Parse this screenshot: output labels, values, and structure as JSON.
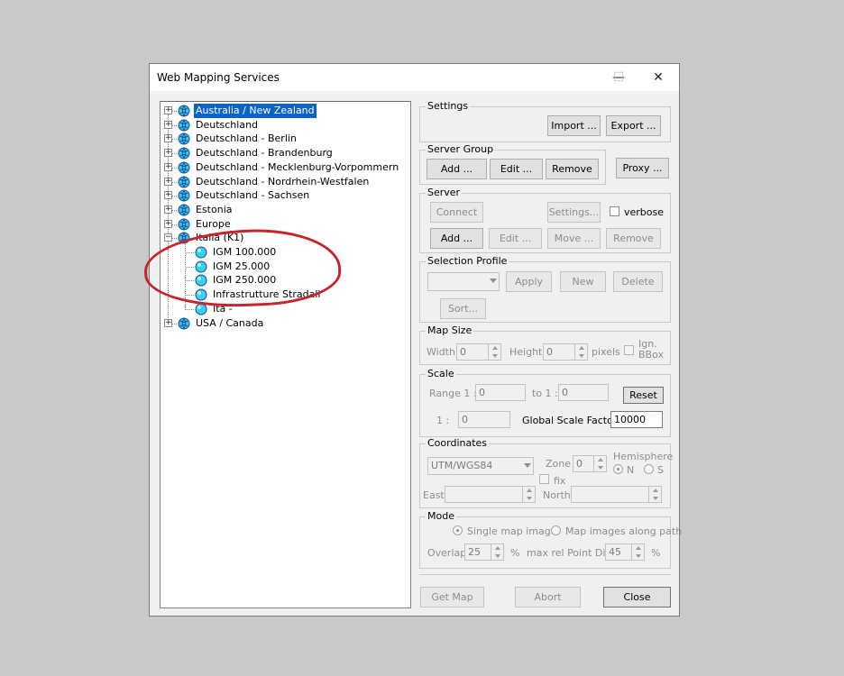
{
  "window": {
    "title": "Web Mapping Services"
  },
  "tree": {
    "items": [
      {
        "label": "Australia / New Zealand",
        "selected": true
      },
      {
        "label": "Deutschland"
      },
      {
        "label": "Deutschland - Berlin"
      },
      {
        "label": "Deutschland - Brandenburg"
      },
      {
        "label": "Deutschland - Mecklenburg-Vorpommern"
      },
      {
        "label": "Deutschland - Nordrhein-Westfalen"
      },
      {
        "label": "Deutschland - Sachsen"
      },
      {
        "label": "Estonia"
      },
      {
        "label": "Europe"
      },
      {
        "label": "Italia (K1)",
        "expanded": true
      },
      {
        "label": "USA / Canada"
      }
    ],
    "children": [
      "IGM 100.000",
      "IGM 25.000",
      "IGM 250.000",
      "Infrastrutture Stradali",
      "Ita -"
    ],
    "annotation_color": "#c8242b"
  },
  "settings": {
    "title": "Settings",
    "import": "Import ...",
    "export": "Export ..."
  },
  "server_group": {
    "title": "Server Group",
    "add": "Add ...",
    "edit": "Edit ...",
    "remove": "Remove",
    "proxy": "Proxy ..."
  },
  "server": {
    "title": "Server",
    "connect": "Connect",
    "settings": "Settings...",
    "verbose": "verbose",
    "add": "Add ...",
    "edit": "Edit ...",
    "move": "Move ...",
    "remove": "Remove"
  },
  "selection_profile": {
    "title": "Selection Profile",
    "apply": "Apply",
    "new": "New",
    "delete": "Delete",
    "sort": "Sort..."
  },
  "map_size": {
    "title": "Map Size",
    "width_label": "Width",
    "width_value": "0",
    "height_label": "Height",
    "height_value": "0",
    "pixels": "pixels",
    "ign_bbox": "Ign. BBox"
  },
  "scale": {
    "title": "Scale",
    "range_label": "Range 1 :",
    "range_from": "0",
    "to_label": "to 1 :",
    "range_to": "0",
    "reset": "Reset",
    "one_label": "1 :",
    "one_value": "0",
    "global_label": "Global Scale Factor",
    "global_value": "10000"
  },
  "coordinates": {
    "title": "Coordinates",
    "system": "UTM/WGS84",
    "zone_label": "Zone",
    "zone_value": "0",
    "hemisphere_label": "Hemisphere",
    "n": "N",
    "s": "S",
    "fix": "fix",
    "east_label": "East",
    "north_label": "North"
  },
  "mode": {
    "title": "Mode",
    "single": "Single map image",
    "along": "Map images along path",
    "overlap_label": "Overlap",
    "overlap_value": "25",
    "percent": "%",
    "maxrel_label": "max rel Point Dist",
    "maxrel_value": "45",
    "percent2": "%"
  },
  "footer": {
    "get_map": "Get Map",
    "abort": "Abort",
    "close": "Close"
  }
}
